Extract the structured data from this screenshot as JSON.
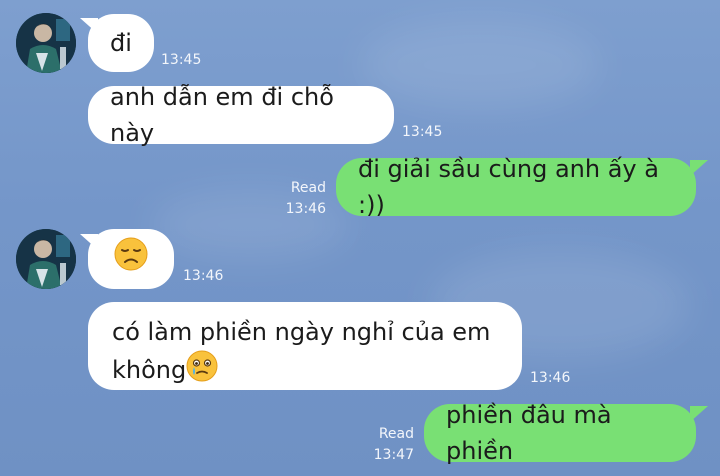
{
  "messages": [
    {
      "side": "in",
      "text": "đi",
      "time": "13:45"
    },
    {
      "side": "in",
      "text": "anh dẫn em đi chỗ này",
      "time": "13:45"
    },
    {
      "side": "out",
      "text": "đi giải sầu cùng anh ấy à :))",
      "status": "Read",
      "time": "13:46"
    },
    {
      "side": "in",
      "emoji": "disappointed-face",
      "time": "13:46"
    },
    {
      "side": "in",
      "text_line1": "có làm phiền ngày nghỉ của em",
      "text_line2": "không",
      "emoji": "face-holding-back-tears",
      "time": "13:46"
    },
    {
      "side": "out",
      "text": "phiền đâu mà phiền",
      "status": "Read",
      "time": "13:47"
    }
  ],
  "colors": {
    "background": "#7496c9",
    "incoming_bubble": "#ffffff",
    "outgoing_bubble": "#79e074",
    "meta_text": "#f3f6fb"
  }
}
